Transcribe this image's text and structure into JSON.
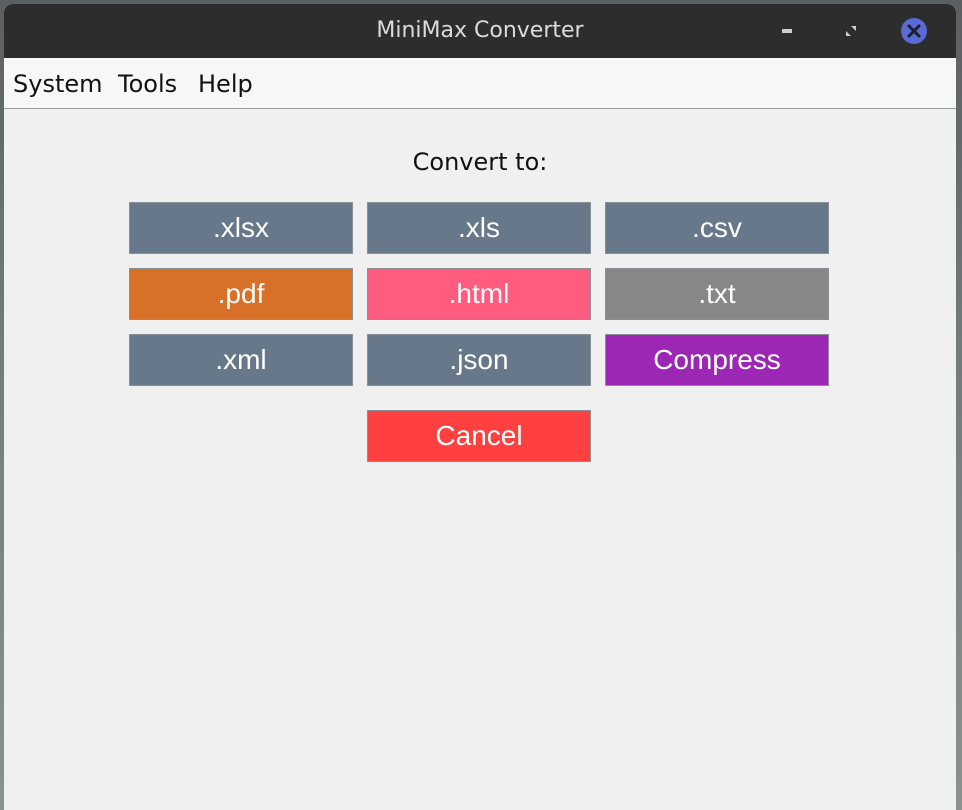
{
  "window": {
    "title": "MiniMax Converter"
  },
  "window_controls": {
    "minimize_icon": "minimize-icon",
    "maximize_icon": "maximize-icon",
    "close_icon": "close-icon",
    "close_color": "#5a6bd6"
  },
  "menu": {
    "items": [
      "System",
      "Tools",
      "Help"
    ]
  },
  "main": {
    "prompt": "Convert to:",
    "buttons": [
      {
        "label": ".xlsx",
        "color": "#66788a"
      },
      {
        "label": ".xls",
        "color": "#66788a"
      },
      {
        "label": ".csv",
        "color": "#66788a"
      },
      {
        "label": ".pdf",
        "color": "#d97027"
      },
      {
        "label": ".html",
        "color": "#ff5c7f"
      },
      {
        "label": ".txt",
        "color": "#878787"
      },
      {
        "label": ".xml",
        "color": "#66788a"
      },
      {
        "label": ".json",
        "color": "#66788a"
      },
      {
        "label": "Compress",
        "color": "#9c27b5"
      }
    ],
    "cancel": {
      "label": "Cancel",
      "color": "#ff4040"
    }
  }
}
